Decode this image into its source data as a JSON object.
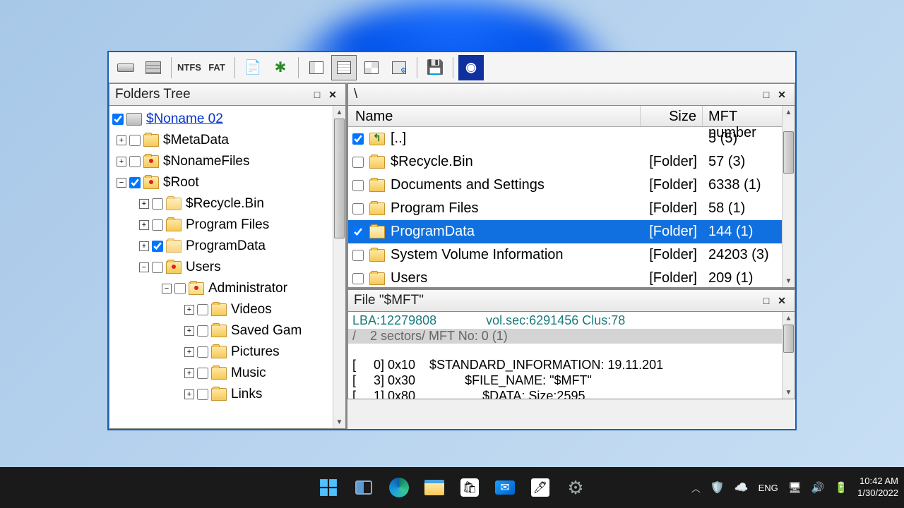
{
  "toolbar": {
    "ntfs": "NTFS",
    "fat": "FAT"
  },
  "panels": {
    "tree": {
      "title": "Folders Tree"
    },
    "list": {
      "title": "\\",
      "cols": {
        "name": "Name",
        "size": "Size",
        "mft": "MFT number"
      }
    },
    "file": {
      "title": "File \"$MFT\""
    }
  },
  "tree": {
    "root": "$Noname 02",
    "metadata": "$MetaData",
    "nonamefiles": "$NonameFiles",
    "sroot": "$Root",
    "recycle": "$Recycle.Bin",
    "progfiles": "Program Files",
    "progdata": "ProgramData",
    "users": "Users",
    "admin": "Administrator",
    "videos": "Videos",
    "savedgames": "Saved Gam",
    "pictures": "Pictures",
    "music": "Music",
    "links": "Links"
  },
  "files": [
    {
      "name": "[..]",
      "size": "",
      "mft": "5 (5)",
      "checked": true,
      "up": true
    },
    {
      "name": "$Recycle.Bin",
      "size": "[Folder]",
      "mft": "57 (3)",
      "checked": false
    },
    {
      "name": "Documents and Settings",
      "size": "[Folder]",
      "mft": "6338 (1)",
      "checked": false
    },
    {
      "name": "Program Files",
      "size": "[Folder]",
      "mft": "58 (1)",
      "checked": false
    },
    {
      "name": "ProgramData",
      "size": "[Folder]",
      "mft": "144 (1)",
      "checked": true,
      "sel": true
    },
    {
      "name": "System Volume Information",
      "size": "[Folder]",
      "mft": "24203 (3)",
      "checked": false
    },
    {
      "name": "Users",
      "size": "[Folder]",
      "mft": "209 (1)",
      "checked": false
    }
  ],
  "mft": {
    "l1": "LBA:12279808              vol.sec:6291456 Clus:78",
    "l2": "/    2 sectors/ MFT No: 0 (1)",
    "l3": "[     0] 0x10    $STANDARD_INFORMATION: 19.11.201",
    "l4": "[     3] 0x30              $FILE_NAME: \"$MFT\"",
    "l5": "[     1] 0x80                   $DATA: Size:2595"
  },
  "taskbar": {
    "lang": "ENG",
    "time": "10:42 AM",
    "date": "1/30/2022"
  }
}
